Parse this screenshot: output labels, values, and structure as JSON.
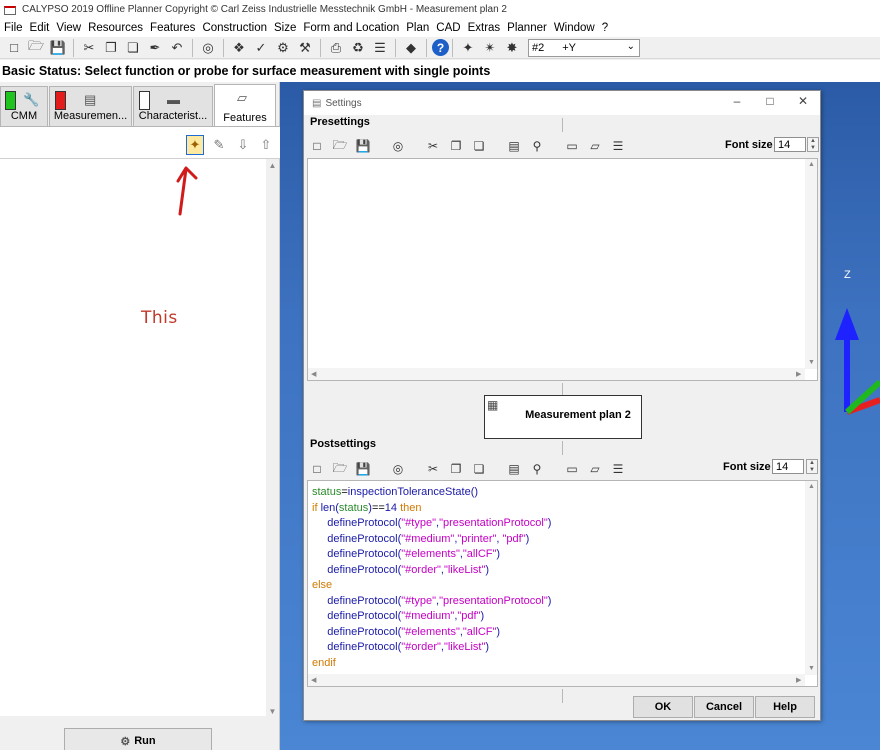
{
  "window": {
    "title": "CALYPSO 2019 Offline Planner Copyright © Carl Zeiss Industrielle Messtechnik GmbH - Measurement plan 2"
  },
  "menu": [
    "File",
    "Edit",
    "View",
    "Resources",
    "Features",
    "Construction",
    "Size",
    "Form and Location",
    "Plan",
    "CAD",
    "Extras",
    "Planner",
    "Window",
    "?"
  ],
  "toolbar": {
    "probe_select": {
      "value": "#2",
      "direction": "+Y"
    }
  },
  "status_line": "Basic Status: Select function or probe for surface measurement with single points",
  "left_panel": {
    "tabs": [
      {
        "label": "CMM",
        "indicator_color": "#1fc41f",
        "icon": "wrench-icon"
      },
      {
        "label": "Measuremen...",
        "indicator_color": "#e21b1b",
        "icon": "document-icon"
      },
      {
        "label": "Characterist...",
        "indicator_color": "#ffffff",
        "icon": "ruler-icon"
      },
      {
        "label": "Features",
        "icon": "shapes-icon",
        "active": true
      }
    ],
    "annotation": "This",
    "annotation_color": "#c0392b",
    "run_label": "Run"
  },
  "viewport": {
    "axis_label": "Z"
  },
  "settings": {
    "title": "Settings",
    "presettings_label": "Presettings",
    "postsettings_label": "Postsettings",
    "font_size_label": "Font size",
    "presettings_font_size": "14",
    "postsettings_font_size": "14",
    "plan_name": "Measurement plan 2",
    "buttons": {
      "ok": "OK",
      "cancel": "Cancel",
      "help": "Help"
    },
    "code_lines": [
      [
        [
          "c-green",
          "status"
        ],
        [
          "c-black",
          "="
        ],
        [
          "c-blue",
          "inspectionToleranceState()"
        ]
      ],
      [
        [
          "c-orange",
          "if "
        ],
        [
          "c-blue",
          "len("
        ],
        [
          "c-green",
          "status"
        ],
        [
          "c-blue",
          ")"
        ],
        [
          "c-black",
          "=="
        ],
        [
          "c-blue",
          "14 "
        ],
        [
          "c-orange",
          "then"
        ]
      ],
      [
        [
          "c-black",
          "     "
        ],
        [
          "c-blue",
          "defineProtocol("
        ],
        [
          "c-magenta",
          "\"#type\""
        ],
        [
          "c-blue",
          ","
        ],
        [
          "c-magenta",
          "\"presentationProtocol\""
        ],
        [
          "c-blue",
          ")"
        ]
      ],
      [
        [
          "c-black",
          "     "
        ],
        [
          "c-blue",
          "defineProtocol("
        ],
        [
          "c-magenta",
          "\"#medium\""
        ],
        [
          "c-blue",
          ","
        ],
        [
          "c-magenta",
          "\"printer\""
        ],
        [
          "c-blue",
          ", "
        ],
        [
          "c-magenta",
          "\"pdf\""
        ],
        [
          "c-blue",
          ")"
        ]
      ],
      [
        [
          "c-black",
          "     "
        ],
        [
          "c-blue",
          "defineProtocol("
        ],
        [
          "c-magenta",
          "\"#elements\""
        ],
        [
          "c-blue",
          ","
        ],
        [
          "c-magenta",
          "\"allCF\""
        ],
        [
          "c-blue",
          ")"
        ]
      ],
      [
        [
          "c-black",
          "     "
        ],
        [
          "c-blue",
          "defineProtocol("
        ],
        [
          "c-magenta",
          "\"#order\""
        ],
        [
          "c-blue",
          ","
        ],
        [
          "c-magenta",
          "\"likeList\""
        ],
        [
          "c-blue",
          ")"
        ]
      ],
      [
        [
          "c-orange",
          "else"
        ]
      ],
      [
        [
          "c-black",
          "     "
        ],
        [
          "c-blue",
          "defineProtocol("
        ],
        [
          "c-magenta",
          "\"#type\""
        ],
        [
          "c-blue",
          ","
        ],
        [
          "c-magenta",
          "\"presentationProtocol\""
        ],
        [
          "c-blue",
          ")"
        ]
      ],
      [
        [
          "c-black",
          "     "
        ],
        [
          "c-blue",
          "defineProtocol("
        ],
        [
          "c-magenta",
          "\"#medium\""
        ],
        [
          "c-blue",
          ","
        ],
        [
          "c-magenta",
          "\"pdf\""
        ],
        [
          "c-blue",
          ")"
        ]
      ],
      [
        [
          "c-black",
          "     "
        ],
        [
          "c-blue",
          "defineProtocol("
        ],
        [
          "c-magenta",
          "\"#elements\""
        ],
        [
          "c-blue",
          ","
        ],
        [
          "c-magenta",
          "\"allCF\""
        ],
        [
          "c-blue",
          ")"
        ]
      ],
      [
        [
          "c-black",
          "     "
        ],
        [
          "c-blue",
          "defineProtocol("
        ],
        [
          "c-magenta",
          "\"#order\""
        ],
        [
          "c-blue",
          ","
        ],
        [
          "c-magenta",
          "\"likeList\""
        ],
        [
          "c-blue",
          ")"
        ]
      ],
      [
        [
          "c-orange",
          "endif"
        ]
      ]
    ]
  }
}
